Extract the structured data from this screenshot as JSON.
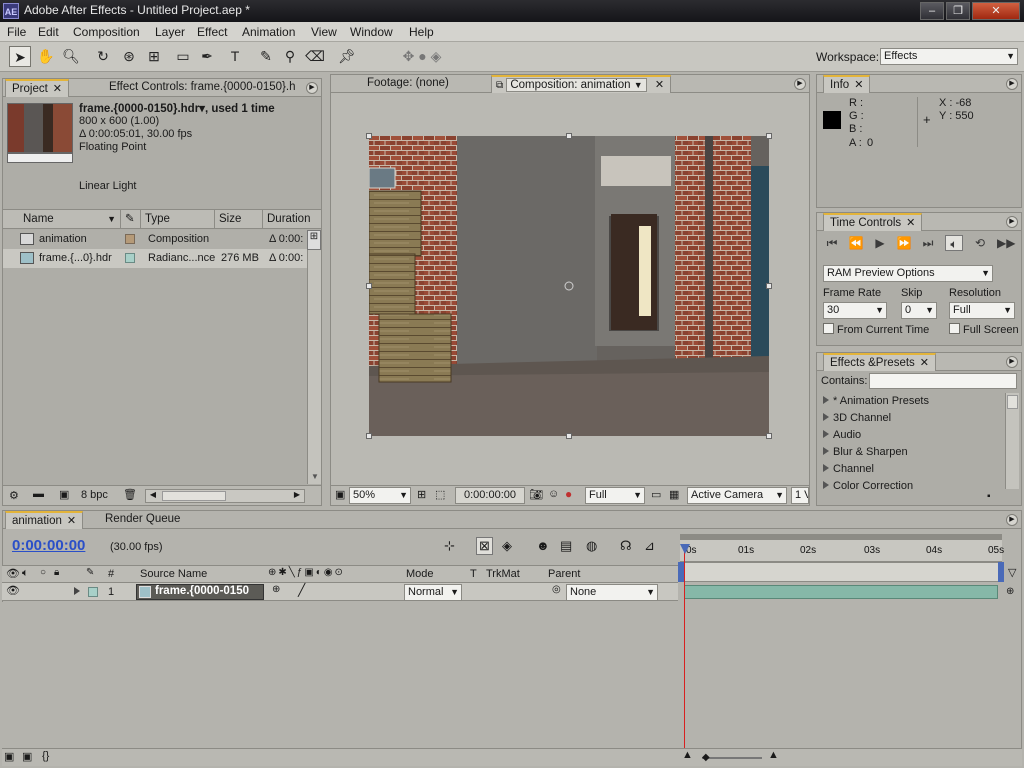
{
  "window": {
    "app_icon": "AE",
    "title": "Adobe After Effects - Untitled Project.aep *"
  },
  "menus": [
    "File",
    "Edit",
    "Composition",
    "Layer",
    "Effect",
    "Animation",
    "View",
    "Window",
    "Help"
  ],
  "workspace": {
    "label": "Workspace:",
    "value": "Effects"
  },
  "project_panel": {
    "tab_project": "Project",
    "tab_effect_controls": "Effect Controls: frame.{0000-0150}.h",
    "item_title": "frame.{0000-0150}.hdr▾, used 1 time",
    "item_size": "800 x 600 (1.00)",
    "item_duration": "Δ 0:00:05:01, 30.00 fps",
    "item_depth": "Floating Point",
    "item_colorspace": "Linear Light",
    "columns": [
      "Name",
      "Type",
      "Size",
      "Duration"
    ],
    "rows": [
      {
        "name": "animation",
        "type": "Composition",
        "size": "",
        "duration": "Δ 0:00:",
        "swatch": "#b59a78"
      },
      {
        "name": "frame.{...0}.hdr",
        "type": "Radianc...nce",
        "size": "276 MB",
        "duration": "Δ 0:00:",
        "swatch": "#a8d0c8"
      }
    ],
    "bpc": "8 bpc"
  },
  "viewer": {
    "tab_footage": "Footage: (none)",
    "tab_composition": "Composition: animation",
    "zoom": "50%",
    "timecode": "0:00:00:00",
    "resolution": "Full",
    "camera": "Active Camera",
    "views": "1 V"
  },
  "info_panel": {
    "tab": "Info",
    "r_label": "R :",
    "g_label": "G :",
    "b_label": "B :",
    "a_label": "A :",
    "a_value": "0",
    "x_label": "X : -68",
    "y_label": "Y : 550"
  },
  "time_controls": {
    "tab": "Time Controls",
    "ram_preview": "RAM Preview Options",
    "frame_rate_label": "Frame Rate",
    "skip_label": "Skip",
    "resolution_label": "Resolution",
    "frame_rate_value": "30",
    "skip_value": "0",
    "resolution_value": "Full",
    "from_current_time": "From Current Time",
    "full_screen": "Full Screen"
  },
  "effects_presets": {
    "tab": "Effects &Presets",
    "contains_label": "Contains:",
    "items": [
      "* Animation Presets",
      "3D Channel",
      "Audio",
      "Blur & Sharpen",
      "Channel",
      "Color Correction"
    ]
  },
  "timeline": {
    "tab_animation": "animation",
    "tab_render_queue": "Render Queue",
    "timecode": "0:00:00:00",
    "fps": "(30.00 fps)",
    "columns": {
      "hash": "#",
      "source_name": "Source Name",
      "mode": "Mode",
      "t": "T",
      "trkmat": "TrkMat",
      "parent": "Parent"
    },
    "ruler_ticks": [
      "0s",
      "01s",
      "02s",
      "03s",
      "04s",
      "05s"
    ],
    "layers": [
      {
        "index": "1",
        "source_name": "frame.{0000-0150",
        "mode": "Normal",
        "parent": "None"
      }
    ]
  },
  "colors": {
    "accent_tab": "#e3b43a",
    "timecode_blue": "#2a4fc8",
    "layer_bar": "#86b8a8",
    "playhead": "#d82020"
  }
}
